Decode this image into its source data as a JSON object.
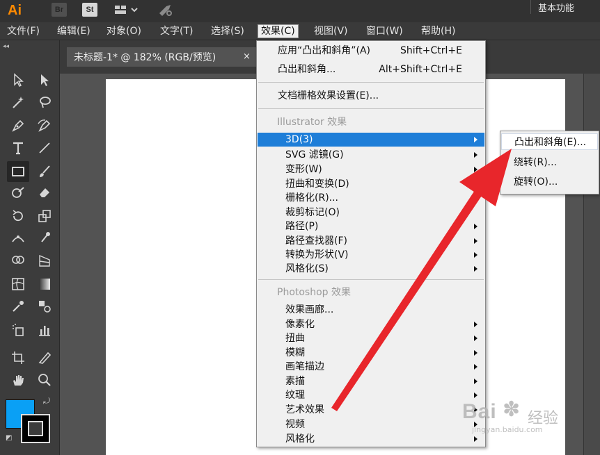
{
  "app": {
    "logo": "Ai",
    "bridge_label": "Br",
    "stock_label": "St",
    "workspace": "基本功能"
  },
  "menubar": {
    "items": [
      {
        "label": "文件(F)"
      },
      {
        "label": "编辑(E)"
      },
      {
        "label": "对象(O)"
      },
      {
        "label": "文字(T)"
      },
      {
        "label": "选择(S)"
      },
      {
        "label": "效果(C)"
      },
      {
        "label": "视图(V)"
      },
      {
        "label": "窗口(W)"
      },
      {
        "label": "帮助(H)"
      }
    ],
    "active": "效果(C)"
  },
  "document": {
    "tab_title": "未标题-1* @ 182% (RGB/预览)",
    "close": "×"
  },
  "effects_menu": {
    "apply_last": {
      "label": "应用“凸出和斜角”(A)",
      "shortcut": "Shift+Ctrl+E"
    },
    "last": {
      "label": "凸出和斜角...",
      "shortcut": "Alt+Shift+Ctrl+E"
    },
    "raster_settings": "文档栅格效果设置(E)...",
    "illustrator_header": "Illustrator 效果",
    "illustrator_items": [
      {
        "label": "3D(3)",
        "submenu": true
      },
      {
        "label": "SVG 滤镜(G)",
        "submenu": true
      },
      {
        "label": "变形(W)",
        "submenu": true
      },
      {
        "label": "扭曲和变换(D)",
        "submenu": true
      },
      {
        "label": "栅格化(R)...",
        "submenu": false
      },
      {
        "label": "裁剪标记(O)",
        "submenu": false
      },
      {
        "label": "路径(P)",
        "submenu": true
      },
      {
        "label": "路径查找器(F)",
        "submenu": true
      },
      {
        "label": "转换为形状(V)",
        "submenu": true
      },
      {
        "label": "风格化(S)",
        "submenu": true
      }
    ],
    "photoshop_header": "Photoshop 效果",
    "photoshop_items": [
      {
        "label": "效果画廊...",
        "submenu": false
      },
      {
        "label": "像素化",
        "submenu": true
      },
      {
        "label": "扭曲",
        "submenu": true
      },
      {
        "label": "模糊",
        "submenu": true
      },
      {
        "label": "画笔描边",
        "submenu": true
      },
      {
        "label": "素描",
        "submenu": true
      },
      {
        "label": "纹理",
        "submenu": true
      },
      {
        "label": "艺术效果",
        "submenu": true
      },
      {
        "label": "视频",
        "submenu": true
      },
      {
        "label": "风格化",
        "submenu": true
      }
    ]
  },
  "submenu_3d": {
    "items": [
      "凸出和斜角(E)...",
      "绕转(R)...",
      "旋转(O)..."
    ]
  },
  "colors": {
    "fill": "#0aa0f5",
    "stroke": "#000000",
    "highlight": "#1e7ed8",
    "annotation_arrow": "#e8262b"
  },
  "watermark": {
    "brand": "Bai",
    "brand_suffix": "经验",
    "url": "jingyan.baidu.com"
  }
}
